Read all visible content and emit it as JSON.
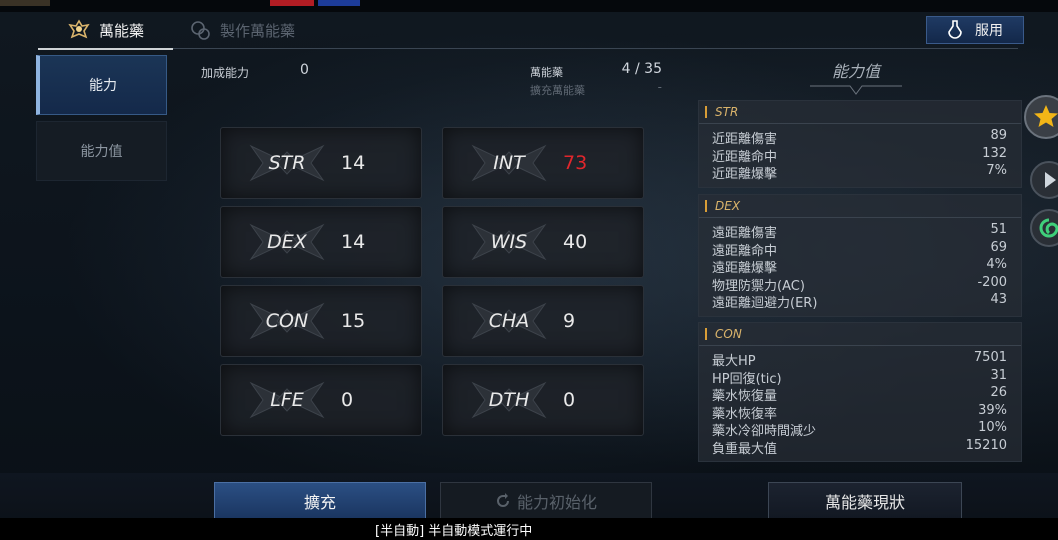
{
  "tabs": [
    {
      "label": "萬能藥",
      "icon": "elixir-emblem-icon"
    },
    {
      "label": "製作萬能藥",
      "icon": "craft-elixir-icon"
    }
  ],
  "use_button": {
    "label": "服用",
    "icon": "potion-flask-icon"
  },
  "sidebar": {
    "items": [
      {
        "label": "能力"
      },
      {
        "label": "能力值"
      }
    ]
  },
  "bonus": {
    "label": "加成能力",
    "value": "0"
  },
  "elixir": {
    "label": "萬能藥",
    "value": "4 / 35",
    "sub_label": "擴充萬能藥",
    "sub_value": "-"
  },
  "stats": [
    {
      "name": "STR",
      "value": "14",
      "color": "#e9e9e9"
    },
    {
      "name": "INT",
      "value": "73",
      "color": "#e1262c"
    },
    {
      "name": "DEX",
      "value": "14",
      "color": "#e9e9e9"
    },
    {
      "name": "WIS",
      "value": "40",
      "color": "#e9e9e9"
    },
    {
      "name": "CON",
      "value": "15",
      "color": "#e9e9e9"
    },
    {
      "name": "CHA",
      "value": "9",
      "color": "#e9e9e9"
    },
    {
      "name": "LFE",
      "value": "0",
      "color": "#e9e9e9"
    },
    {
      "name": "DTH",
      "value": "0",
      "color": "#e9e9e9"
    }
  ],
  "panel": {
    "title": "能力值",
    "groups": [
      {
        "header": "STR",
        "rows": [
          {
            "label": "近距離傷害",
            "value": "89"
          },
          {
            "label": "近距離命中",
            "value": "132"
          },
          {
            "label": "近距離爆擊",
            "value": "7%"
          }
        ]
      },
      {
        "header": "DEX",
        "rows": [
          {
            "label": "遠距離傷害",
            "value": "51"
          },
          {
            "label": "遠距離命中",
            "value": "69"
          },
          {
            "label": "遠距離爆擊",
            "value": "4%"
          },
          {
            "label": "物理防禦力(AC)",
            "value": "-200"
          },
          {
            "label": "遠距離迴避力(ER)",
            "value": "43"
          }
        ]
      },
      {
        "header": "CON",
        "rows": [
          {
            "label": "最大HP",
            "value": "7501"
          },
          {
            "label": "HP回復(tic)",
            "value": "31"
          },
          {
            "label": "藥水恢復量",
            "value": "26"
          },
          {
            "label": "藥水恢復率",
            "value": "39%"
          },
          {
            "label": "藥水冷卻時間減少",
            "value": "10%"
          },
          {
            "label": "負重最大值",
            "value": "15210"
          }
        ]
      }
    ]
  },
  "side_icons": [
    "star-icon",
    "play-icon",
    "swirl-icon"
  ],
  "bottom": {
    "expand": "擴充",
    "reset": "能力初始化",
    "status": "萬能藥現狀"
  },
  "system_message": "[半自動] 半自動模式運行中",
  "colors": {
    "accent": "#2b4f83",
    "header_text": "#d9b36b",
    "header_bar": "#d89d37",
    "highlight": "#e1262c"
  }
}
